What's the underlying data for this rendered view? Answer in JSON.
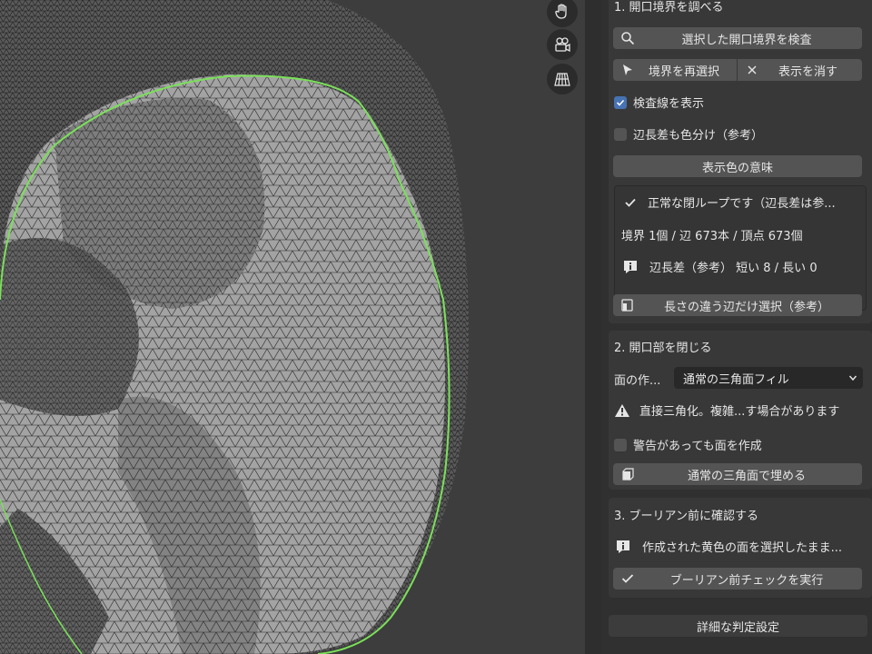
{
  "viewport": {
    "gizmo_icons": [
      "hand-icon",
      "camera-icon",
      "grid-icon"
    ]
  },
  "section1": {
    "title": "1. 開口境界を調べる",
    "inspect_button": "選択した開口境界を検査",
    "reselect_button": "境界を再選択",
    "clear_display_button": "表示を消す",
    "show_lines_checkbox": "検査線を表示",
    "show_lines_checked": true,
    "color_by_length_checkbox": "辺長差も色分け（参考）",
    "color_by_length_checked": false,
    "color_meaning_button": "表示色の意味",
    "info": {
      "status": "正常な閉ループです（辺長差は参...",
      "stats": "境界 1個 / 辺 673本 / 頂点 673個",
      "length_diff": "辺長差（参考） 短い 8 / 長い 0"
    },
    "select_diff_button": "長さの違う辺だけ選択（参考）"
  },
  "section2": {
    "title": "2. 開口部を閉じる",
    "fill_label": "面の作...",
    "fill_select_value": "通常の三角面フィル",
    "warning_text": "直接三角化。複雑...す場合があります",
    "force_checkbox": "警告があっても面を作成",
    "force_checked": false,
    "fill_button": "通常の三角面で埋める"
  },
  "section3": {
    "title": "3. ブーリアン前に確認する",
    "info_text": "作成された黄色の面を選択したまま...",
    "check_button": "ブーリアン前チェックを実行"
  },
  "advanced_button": "詳細な判定設定",
  "colors": {
    "panel": "#383838",
    "button": "#545454",
    "checkbox_on": "#4772b3",
    "boundary_line": "#7be05a",
    "mesh_fill": "#9e9e9e"
  }
}
